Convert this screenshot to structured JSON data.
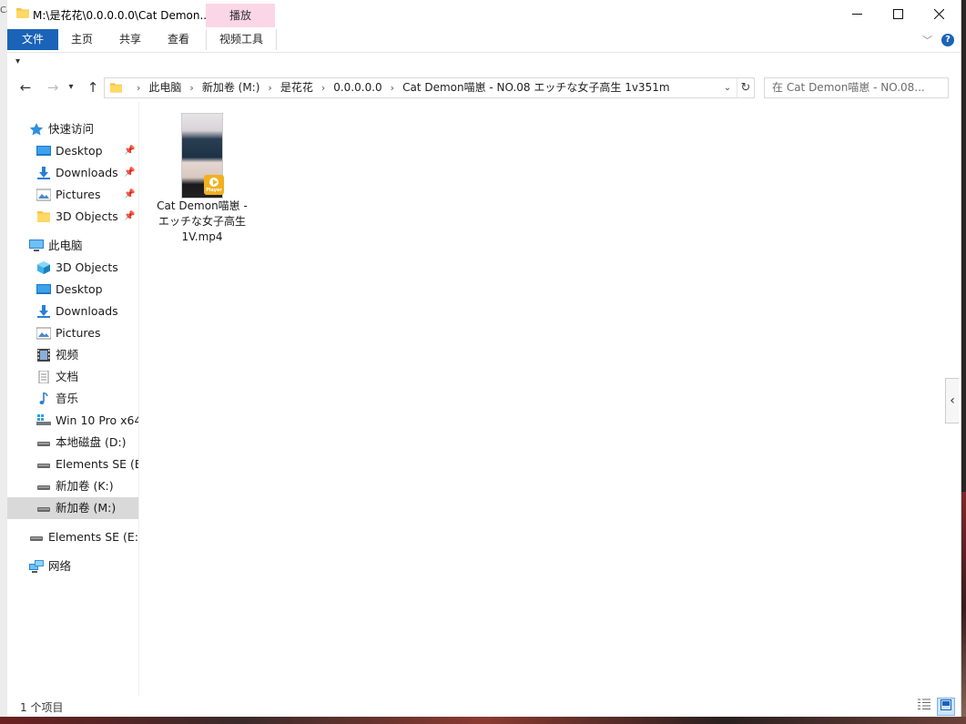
{
  "window": {
    "title": "M:\\是花花\\0.0.0.0.0\\Cat Demon...",
    "contextual_tab": "播放"
  },
  "ribbon": {
    "tabs": [
      "文件",
      "主页",
      "共享",
      "查看",
      "视频工具"
    ]
  },
  "address": {
    "crumbs": [
      "此电脑",
      "新加卷 (M:)",
      "是花花",
      "0.0.0.0.0",
      "Cat Demon喵崽 - NO.08 エッチな女子高生 1v351m"
    ]
  },
  "search": {
    "placeholder": "在 Cat Demon喵崽 - NO.08..."
  },
  "nav": {
    "quick_access": "快速访问",
    "quick": [
      "Desktop",
      "Downloads",
      "Pictures",
      "3D Objects"
    ],
    "this_pc": "此电脑",
    "pc": [
      "3D Objects",
      "Desktop",
      "Downloads",
      "Pictures",
      "视频",
      "文档",
      "音乐",
      "Win 10 Pro x64",
      "本地磁盘 (D:)",
      "Elements SE (E:",
      "新加卷 (K:)",
      "新加卷 (M:)"
    ],
    "elements": "Elements SE (E:)",
    "network": "网络"
  },
  "file": {
    "name": "Cat Demon喵崽 - エッチな女子高生 1V.mp4",
    "badge": "Player"
  },
  "status": {
    "count": "1 个项目"
  },
  "colors": {
    "accent": "#1a63b8",
    "contextual": "#fbd6e6",
    "selection": "#d9d9d9"
  }
}
